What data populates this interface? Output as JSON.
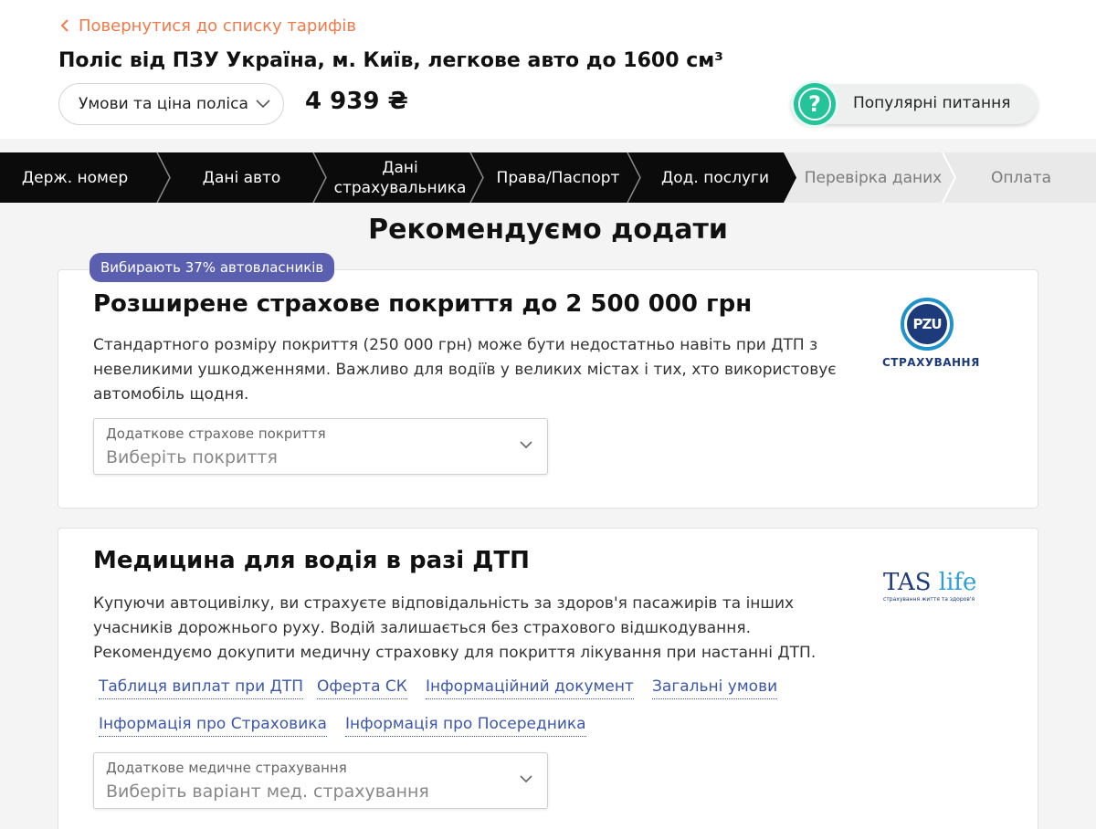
{
  "header": {
    "back_link": "Повернутися до списку тарифів",
    "title": "Поліс від ПЗУ Україна, м. Київ, легкове авто до 1600 см³",
    "conditions_button": "Умови та ціна поліса",
    "price": "4 939 ₴",
    "faq_button": "Популярні питання",
    "faq_icon": "?"
  },
  "steps": [
    {
      "label": "Держ. номер",
      "state": "done"
    },
    {
      "label": "Дані авто",
      "state": "done"
    },
    {
      "label": "Дані страхувальника",
      "state": "done"
    },
    {
      "label": "Права/Паспорт",
      "state": "done"
    },
    {
      "label": "Дод. послуги",
      "state": "done"
    },
    {
      "label": "Перевірка даних",
      "state": "todo"
    },
    {
      "label": "Оплата",
      "state": "todo"
    }
  ],
  "main": {
    "heading": "Рекомендуємо додати",
    "card1": {
      "badge": "Вибирають 37% автовласників",
      "title": "Розширене страхове покриття до 2 500 000 грн",
      "text": "Стандартного розміру покриття (250 000 грн) може бути недостатньо навіть при ДТП з невеликими ушкодженнями. Важливо для водіїв у великих містах і тих, хто використовує автомобіль щодня.",
      "select_label": "Додаткове страхове покриття",
      "select_placeholder": "Виберіть покриття",
      "logo_mark": "PZU",
      "logo_text": "СТРАХУВАННЯ"
    },
    "card2": {
      "title": "Медицина для водія в разі ДТП",
      "text": "Купуючи автоцивілку, ви страхуєте відповідальність за здоров'я пасажирів та інших учасників дорожнього руху. Водій залишається без страхового відшкодування. Рекомендуємо докупити медичну страховку для покриття лікування при настанні ДТП.",
      "links": [
        "Таблиця виплат при ДТП",
        "Оферта СК",
        "Інформаційний документ",
        "Загальні умови",
        "Інформація про Страховика",
        "Інформація про Посередника"
      ],
      "select_label": "Додаткове медичне страхування",
      "select_placeholder": "Виберіть варіант мед. страхування",
      "logo_main": "TAS",
      "logo_life": "life",
      "logo_sub": "страхування життя та здоров'я"
    }
  },
  "colors": {
    "accent": "#f07a4a",
    "step_done": "#0b0b0b",
    "step_todo": "#e9e9e9",
    "badge": "#5b5fb0",
    "link": "#3c57a8",
    "faq": "#24c39a"
  },
  "icons": {
    "back": "chevron-left-icon",
    "dropdown": "chevron-down-icon",
    "faq": "question-icon"
  }
}
